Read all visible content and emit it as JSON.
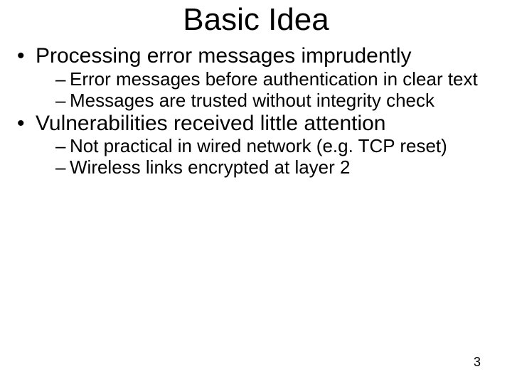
{
  "slide": {
    "title": "Basic Idea",
    "bullets": [
      {
        "text": "Processing error messages imprudently",
        "sub": [
          "Error messages before authentication in clear text",
          "Messages are trusted without integrity check"
        ]
      },
      {
        "text": "Vulnerabilities received little attention",
        "sub": [
          "Not practical in wired network (e.g. TCP reset)",
          "Wireless links encrypted at layer 2"
        ]
      }
    ],
    "page_number": "3"
  }
}
